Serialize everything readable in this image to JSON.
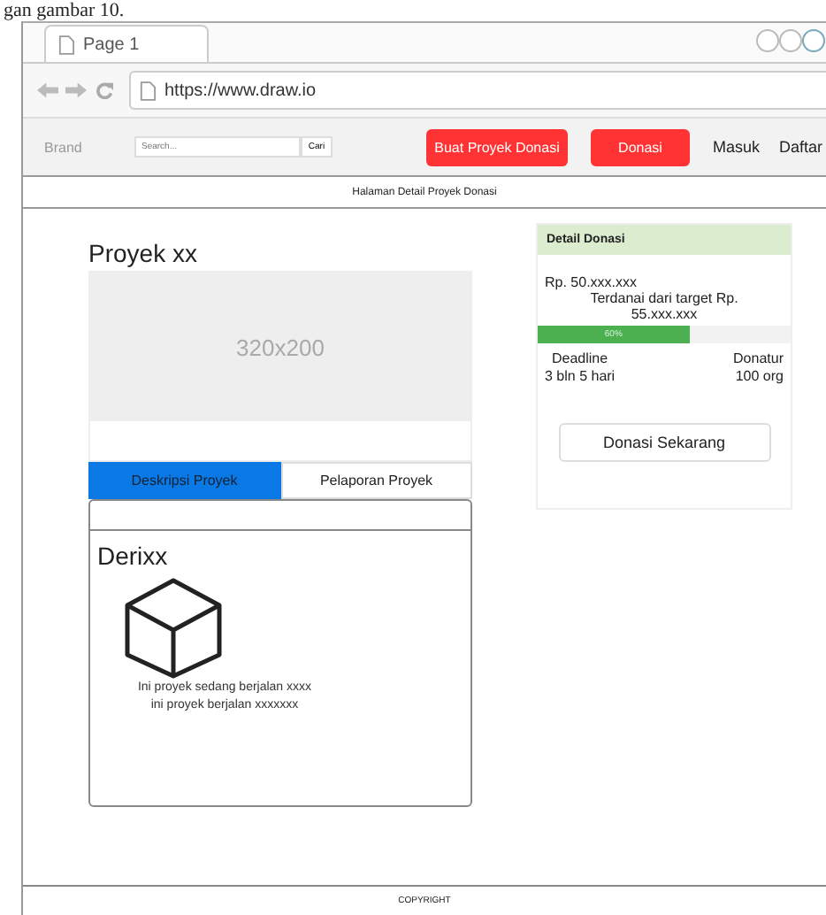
{
  "document_text": "gan gambar 10.",
  "browser": {
    "tab": {
      "label": "Page 1",
      "selected": true
    },
    "url": "https://www.draw.io"
  },
  "navbar": {
    "brand": "Brand",
    "search": {
      "placeholder": "Search...",
      "button": "Cari"
    },
    "buttons": [
      {
        "label": "Buat Proyek Donasi",
        "kind": "primary"
      },
      {
        "label": "Donasi",
        "kind": "primary"
      },
      {
        "label": "Masuk",
        "kind": "link"
      },
      {
        "label": "Daftar",
        "kind": "link"
      }
    ]
  },
  "page_header": "Halaman Detail Proyek Donasi",
  "project": {
    "title": "Proyek xx",
    "image_placeholder": "320x200",
    "tabs": [
      {
        "label": "Deskripsi Proyek",
        "selected": true
      },
      {
        "label": "Pelaporan Proyek",
        "selected": false
      }
    ],
    "panel": {
      "title": "Derixx",
      "lines": [
        "Ini proyek sedang berjalan xxxx",
        "ini proyek berjalan xxxxxxx"
      ]
    }
  },
  "donation": {
    "title": "Detail Donasi",
    "amount": "Rp. 50.xxx.xxx",
    "target_label": "Terdanai dari target Rp.",
    "target": "55.xxx.xxx",
    "progress": {
      "level": 0.6,
      "label": "60%"
    },
    "stats": [
      {
        "label": "Deadline",
        "value": "3 bln 5 hari"
      },
      {
        "label": "Donatur",
        "value": "100 org"
      }
    ],
    "button": "Donasi Sekarang"
  },
  "footer": "COPYRIGHT"
}
